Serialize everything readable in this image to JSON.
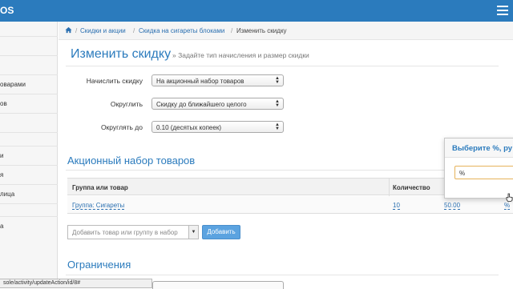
{
  "topbar": {
    "brand": "OS",
    "menu_icon": "hamburger-icon",
    "color": "#2b7bbd"
  },
  "sidebar": {
    "items": [
      {
        "label": ""
      },
      {
        "label": ""
      },
      {
        "label": "оварами"
      },
      {
        "label": "ов"
      },
      {
        "label": ""
      },
      {
        "label": ""
      },
      {
        "label": "и"
      },
      {
        "label": "я"
      },
      {
        "label": "лица"
      },
      {
        "label": ""
      },
      {
        "label": "а"
      }
    ]
  },
  "breadcrumb": {
    "home_icon": "home-icon",
    "items": [
      "Скидки и акции",
      "Скидка на сигареты блоками",
      "Изменить скидку"
    ],
    "separator": "/"
  },
  "page": {
    "title": "Изменить скидку",
    "subtitle": "» Задайте тип начисления и размер скидки"
  },
  "form": {
    "charge_label": "Начислить скидку",
    "charge_value": "На акционный набор товаров",
    "round_label": "Округлить",
    "round_value": "Скидку до ближайшего целого",
    "round_to_label": "Округлять до",
    "round_to_value": "0.10 (десятых копеек)"
  },
  "promo": {
    "title": "Акционный набор товаров",
    "columns": [
      "Группа или товар",
      "Количество"
    ],
    "row": {
      "group": "Группа: Сигареты",
      "qty": "10",
      "amount": "50.00",
      "unit": "%"
    },
    "add_placeholder": "Добавить товар или группу в набор",
    "add_button": "Добавить"
  },
  "popover": {
    "title": "Выберите %, ру",
    "input_value": "%"
  },
  "limits": {
    "title": "Ограничения"
  },
  "statusbar": {
    "url": "sole/activity/updateAction/id/8#"
  },
  "colors": {
    "accent": "#2b7bbd",
    "link": "#2a6fb0",
    "button": "#5ba3e0"
  }
}
